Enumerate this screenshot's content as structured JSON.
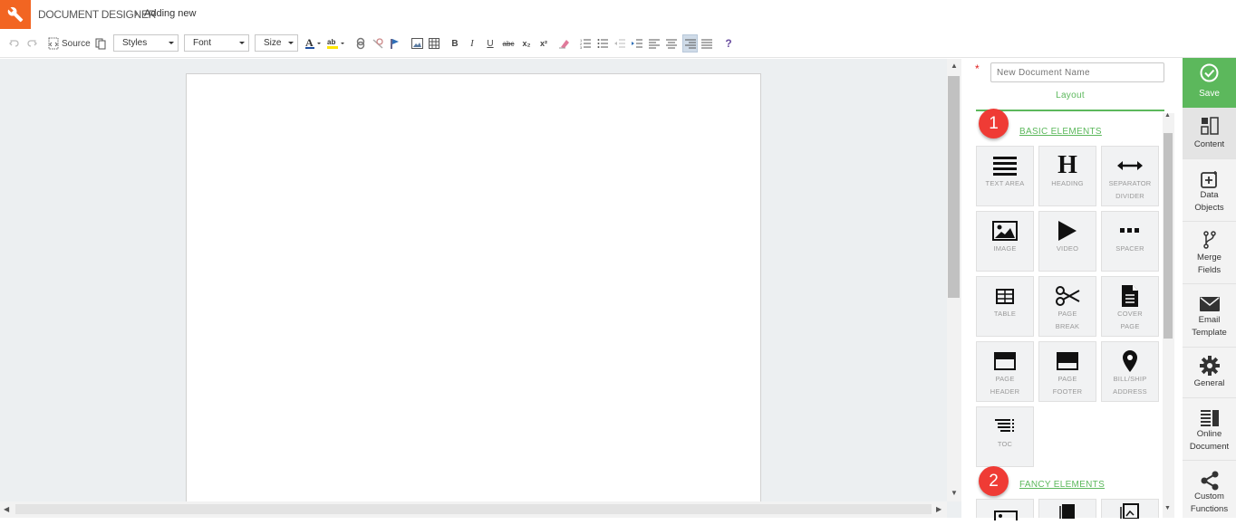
{
  "header": {
    "app_title": "DOCUMENT DESIGNER",
    "breadcrumb_sep": "›",
    "breadcrumb": "Adding new"
  },
  "toolbar": {
    "source_label": "Source",
    "styles_label": "Styles",
    "font_label": "Font",
    "size_label": "Size",
    "bold": "B",
    "italic": "I",
    "underline": "U",
    "strike": "abc",
    "subscript": "x₂",
    "superscript": "x²",
    "help": "?"
  },
  "panel": {
    "required_mark": "*",
    "doc_name_placeholder": "New Document Name",
    "layout_tab": "Layout",
    "basic": {
      "badge": "1",
      "title": "BASIC ELEMENTS",
      "items": [
        {
          "label": "TEXT AREA",
          "icon": "text-area-icon"
        },
        {
          "label": "HEADING",
          "icon": "heading-icon"
        },
        {
          "label": "SEPARATOR\nDIVIDER",
          "icon": "separator-icon"
        },
        {
          "label": "IMAGE",
          "icon": "image-icon"
        },
        {
          "label": "VIDEO",
          "icon": "video-icon"
        },
        {
          "label": "SPACER",
          "icon": "spacer-icon"
        },
        {
          "label": "TABLE",
          "icon": "table-icon"
        },
        {
          "label": "PAGE\nBREAK",
          "icon": "scissors-icon"
        },
        {
          "label": "COVER\nPAGE",
          "icon": "document-icon"
        },
        {
          "label": "PAGE\nHEADER",
          "icon": "page-header-icon"
        },
        {
          "label": "PAGE\nFOOTER",
          "icon": "page-footer-icon"
        },
        {
          "label": "BILL/SHIP\nADDRESS",
          "icon": "map-pin-icon"
        },
        {
          "label": "TOC",
          "icon": "toc-icon"
        }
      ]
    },
    "fancy": {
      "badge": "2",
      "title": "FANCY ELEMENTS"
    }
  },
  "rail": {
    "save": "Save",
    "items": [
      {
        "label": "Content",
        "icon": "content-icon"
      },
      {
        "label": "Data\nObjects",
        "icon": "data-objects-icon"
      },
      {
        "label": "Merge\nFields",
        "icon": "merge-fields-icon"
      },
      {
        "label": "Email\nTemplate",
        "icon": "email-icon"
      },
      {
        "label": "General",
        "icon": "gear-icon"
      },
      {
        "label": "Online\nDocument",
        "icon": "online-document-icon"
      },
      {
        "label": "Custom\nFunctions",
        "icon": "share-icon"
      }
    ]
  },
  "colors": {
    "accent": "#5cb85c",
    "brand": "#f26522",
    "badge": "#ef3b35"
  }
}
